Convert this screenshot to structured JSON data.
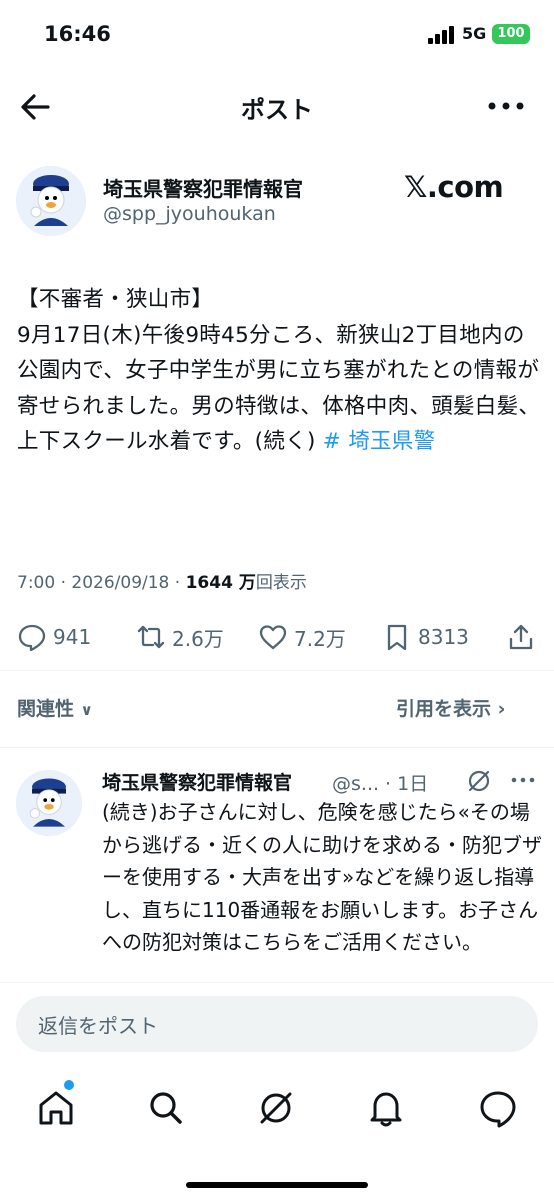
{
  "status": {
    "time": "16:46",
    "network": "5G",
    "battery": "100"
  },
  "header": {
    "title": "ポスト"
  },
  "post": {
    "name": "埼玉県警察犯罪情報官",
    "handle": "@spp_jyouhoukan",
    "brand": "𝕏.com",
    "text": "【不審者・狭山市】\n9月17日(木)午後9時45分ころ、新狭山2丁目地内の公園内で、女子中学生が男に立ち塞がれたとの情報が寄せられました。男の特徴は、体格中肉、頭髪白髪、上下スクール水着です。(続く) ",
    "hashtag": "# 埼玉県警",
    "meta_time": "7:00 · 2026/09/18 · ",
    "views": "1644 万",
    "views_label": "回表示"
  },
  "actions": {
    "replies": "941",
    "reposts": "2.6万",
    "likes": "7.2万",
    "bookmarks": "8313"
  },
  "tabs": {
    "related": "関連性",
    "quotes": "引用を表示"
  },
  "reply": {
    "name": "埼玉県警察犯罪情報官",
    "handle": "@s... · 1日",
    "text": "(続き)お子さんに対し、危険を感じたら«その場から逃げる・近くの人に助けを求める・防犯ブザーを使用する・大声を出す»などを繰り返し指導し、直ちに110番通報をお願いします。お子さんへの防犯対策はこちらをご活用ください。"
  },
  "composer": {
    "placeholder": "返信をポスト"
  },
  "colors": {
    "accent": "#1d9bf0",
    "secondary": "#536471",
    "battery": "#34c759"
  }
}
